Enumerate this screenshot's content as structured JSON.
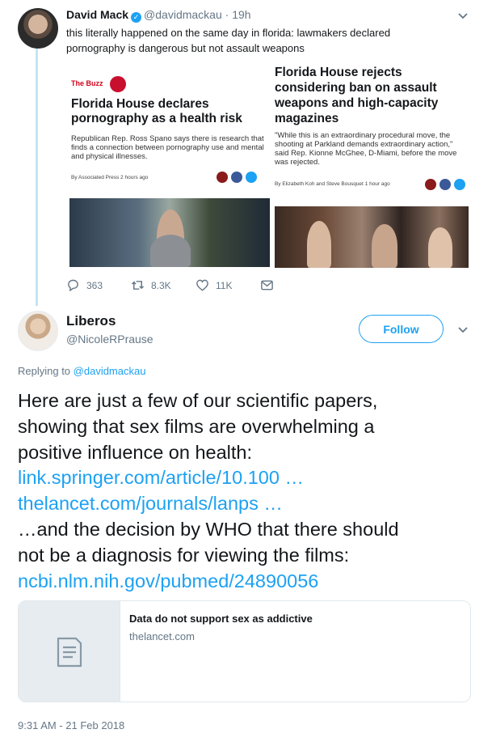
{
  "parent_tweet": {
    "name": "David Mack",
    "handle": "@davidmackau",
    "dot": "·",
    "time": "19h",
    "text": "this literally happened on the same day in florida: lawmakers declared pornography is dangerous but not assault weapons",
    "article_left": {
      "section": "The Buzz",
      "headline": "Florida House declares pornography as a health risk",
      "body": "Republican Rep. Ross Spano says there is research that finds a connection between pornography use and mental and physical illnesses.",
      "byline": "By Associated Press   2 hours ago"
    },
    "article_right": {
      "headline": "Florida House rejects considering ban on assault weapons and high-capacity magazines",
      "body": "\"While this is an extraordinary procedural move, the shooting at Parkland demands extraordinary action,\" said Rep. Kionne McGhee, D-Miami, before the move was rejected.",
      "byline": "By Elizabeth Koh and Steve Bousquet   1 hour ago"
    },
    "actions": {
      "replies": "363",
      "retweets": "8.3K",
      "likes": "11K"
    }
  },
  "reply_tweet": {
    "name": "Liberos",
    "handle": "@NicoleRPrause",
    "follow_label": "Follow",
    "replying_prefix": "Replying to ",
    "replying_handle": "@davidmackau",
    "body_lines": [
      {
        "type": "text",
        "value": "Here are just a few of our scientific papers,"
      },
      {
        "type": "text",
        "value": "showing that sex films are overwhelming a"
      },
      {
        "type": "text",
        "value": "positive influence on health:"
      },
      {
        "type": "link",
        "value": "link.springer.com/article/10.100 …"
      },
      {
        "type": "link",
        "value": "thelancet.com/journals/lanps  …"
      },
      {
        "type": "text",
        "value": "…and the decision by WHO that there should"
      },
      {
        "type": "text",
        "value": "not be a diagnosis for viewing the films:"
      },
      {
        "type": "link",
        "value": "ncbi.nlm.nih.gov/pubmed/24890056"
      }
    ],
    "card": {
      "title": "Data do not support sex as addictive",
      "domain": "thelancet.com"
    },
    "timestamp": "9:31 AM - 21 Feb 2018"
  },
  "colors": {
    "accent": "#1da1f2",
    "text": "#14171a",
    "muted": "#657786",
    "thread_line": "#c4e4f5"
  },
  "icons": [
    "verified-badge-icon",
    "chevron-down-icon",
    "reply-icon",
    "retweet-icon",
    "like-icon",
    "message-icon",
    "document-icon"
  ]
}
